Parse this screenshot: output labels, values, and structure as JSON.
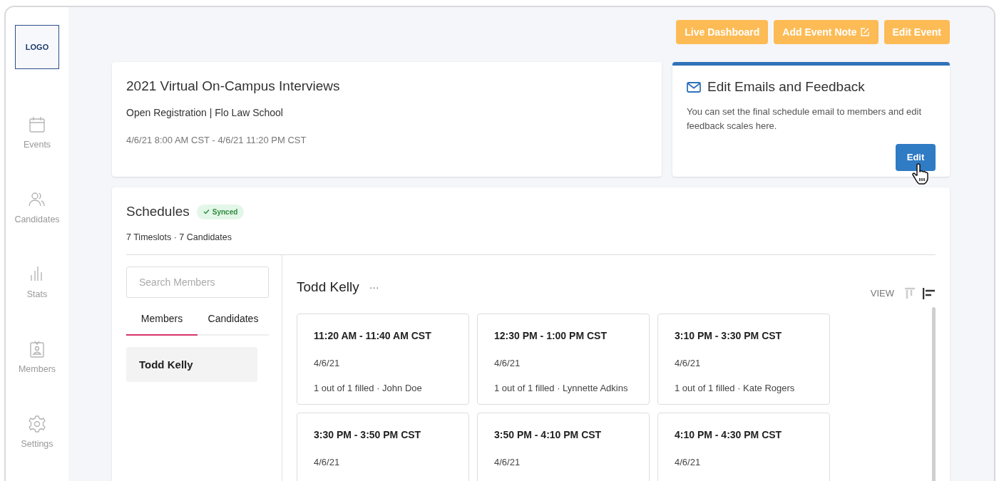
{
  "sidebar": {
    "logo": "LOGO",
    "items": [
      {
        "label": "Events"
      },
      {
        "label": "Candidates"
      },
      {
        "label": "Stats"
      },
      {
        "label": "Members"
      },
      {
        "label": "Settings"
      }
    ]
  },
  "actions": [
    {
      "label": "Live Dashboard",
      "kind": "plain"
    },
    {
      "label": "Add Event Note",
      "kind": "note"
    },
    {
      "label": "Edit Event",
      "kind": "plain"
    }
  ],
  "event": {
    "title": "2021 Virtual On-Campus Interviews",
    "subtitle": "Open Registration | Flo Law School",
    "dates": "4/6/21 8:00 AM CST - 4/6/21 11:20 PM CST"
  },
  "emails": {
    "title": "Edit Emails and Feedback",
    "text": "You can set the final schedule email to members and edit feedback scales here.",
    "button": "Edit"
  },
  "schedules": {
    "title": "Schedules",
    "badge": "Synced",
    "summary": "7 Timeslots · 7 Candidates",
    "search": {
      "placeholder": "Search Members"
    },
    "tabs": [
      {
        "label": "Members",
        "selected": true
      },
      {
        "label": "Candidates",
        "selected": false
      }
    ],
    "members": [
      {
        "name": "Todd Kelly",
        "selected": true
      }
    ],
    "member_title": "Todd Kelly",
    "more": "···",
    "view_label": "VIEW",
    "views": [
      {
        "kind": "columns",
        "selected": false
      },
      {
        "kind": "rows",
        "selected": true
      }
    ],
    "slots": [
      {
        "time": "11:20 AM - 11:40 AM CST",
        "date": "4/6/21",
        "filled": "1 out of 1 filled · John Doe"
      },
      {
        "time": "12:30 PM - 1:00 PM CST",
        "date": "4/6/21",
        "filled": "1 out of 1 filled · Lynnette Adkins"
      },
      {
        "time": "3:10 PM - 3:30 PM CST",
        "date": "4/6/21",
        "filled": "1 out of 1 filled · Kate Rogers"
      },
      {
        "time": "3:30 PM - 3:50 PM CST",
        "date": "4/6/21"
      },
      {
        "time": "3:50 PM - 4:10 PM CST",
        "date": "4/6/21"
      },
      {
        "time": "4:10 PM - 4:30 PM CST",
        "date": "4/6/21"
      }
    ]
  }
}
